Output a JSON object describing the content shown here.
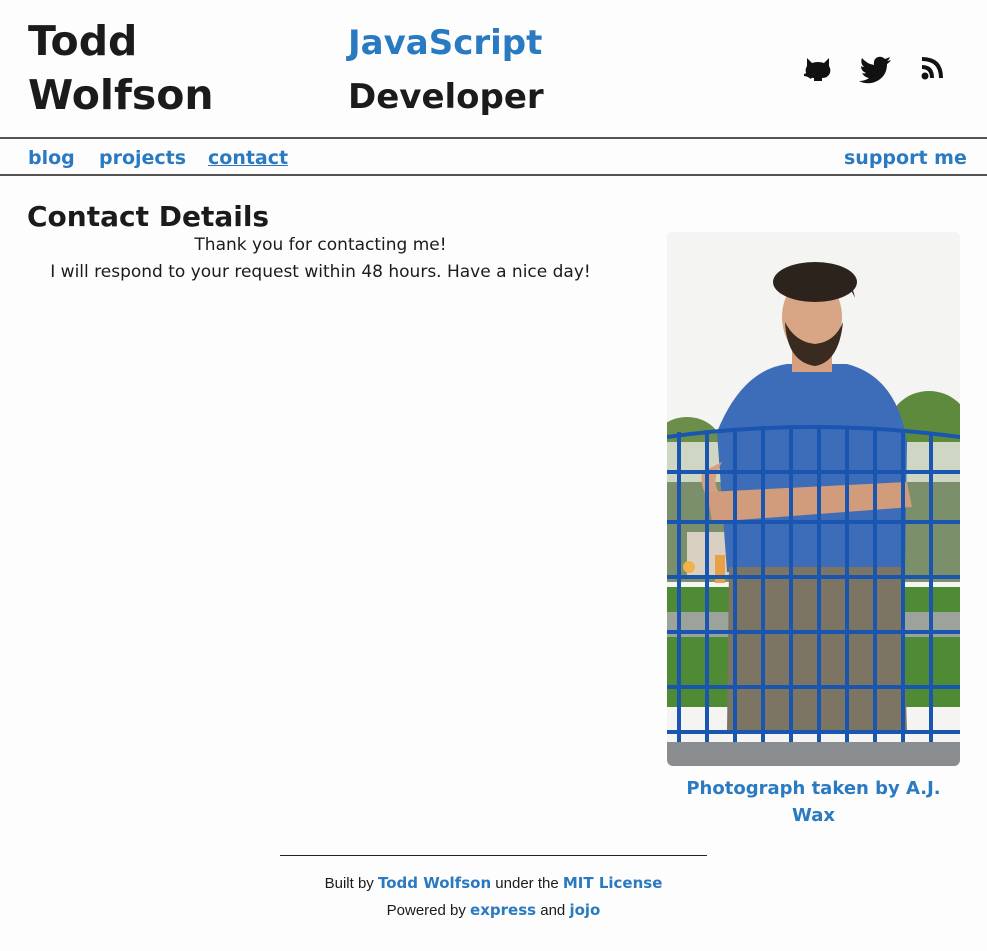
{
  "header": {
    "name_line1": "Todd",
    "name_line2": "Wolfson",
    "role_lang": "JavaScript",
    "role_title": "Developer",
    "social": [
      {
        "icon": "github-icon"
      },
      {
        "icon": "twitter-icon"
      },
      {
        "icon": "rss-icon"
      }
    ]
  },
  "nav": {
    "blog": "blog",
    "projects": "projects",
    "contact": "contact",
    "support": "support me"
  },
  "main": {
    "title": "Contact Details",
    "thanks": "Thank you for contacting me!",
    "response": "I will respond to your request within 48 hours. Have a nice day!",
    "caption": "Photograph taken by A.J. Wax"
  },
  "footer": {
    "built_by": "Built by",
    "author_link": "Todd Wolfson",
    "under_the": "under the",
    "license_link": "MIT License",
    "powered_by": "Powered by",
    "express_link": "express",
    "and": "and",
    "jojo_link": "jojo"
  },
  "colors": {
    "link": "#2a7ac2",
    "text": "#1b1b1b",
    "background": "#fdfdfd"
  }
}
